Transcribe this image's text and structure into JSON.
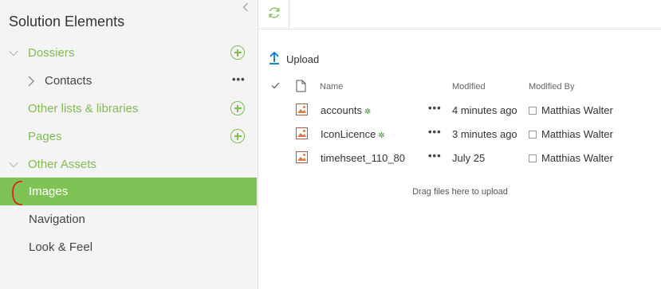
{
  "sidebar": {
    "title": "Solution Elements",
    "collapse_icon": "chevron-left-icon",
    "items": [
      {
        "label": "Dossiers",
        "color": "#7fbd51",
        "caret": "chevron-down-icon",
        "has_add": true
      },
      {
        "label": "Contacts",
        "caret": "chevron-right-icon",
        "has_more": true
      },
      {
        "label": "Other lists & libraries",
        "color": "#7fbd51",
        "has_add": true
      },
      {
        "label": "Pages",
        "color": "#7fbd51",
        "has_add": true
      },
      {
        "label": "Other Assets",
        "color": "#7fbd51",
        "caret": "chevron-down-icon"
      },
      {
        "label": "Images",
        "selected": true,
        "selected_color": "#7fc255"
      },
      {
        "label": "Navigation"
      },
      {
        "label": "Look & Feel"
      }
    ]
  },
  "toolbar": {
    "refresh_icon": "refresh-icon",
    "upload_label": "Upload"
  },
  "library": {
    "columns": {
      "name": "Name",
      "modified": "Modified",
      "modified_by": "Modified By"
    },
    "files": [
      {
        "name": "accounts",
        "modified": "4 minutes ago",
        "modified_by": "Matthias Walter",
        "is_new": true
      },
      {
        "name": "IconLicence",
        "modified": "3 minutes ago",
        "modified_by": "Matthias Walter",
        "is_new": true
      },
      {
        "name": "timehseet_110_80",
        "modified": "July 25",
        "modified_by": "Matthias Walter",
        "is_new": false
      }
    ],
    "drop_hint": "Drag files here to upload",
    "new_badge_symbol": "✲",
    "more_symbol": "•••"
  },
  "colors": {
    "accent": "#7fbd51",
    "selected_bg": "#7fc255",
    "upload_arrow": "#0078d4",
    "annotation": "#e02020"
  }
}
